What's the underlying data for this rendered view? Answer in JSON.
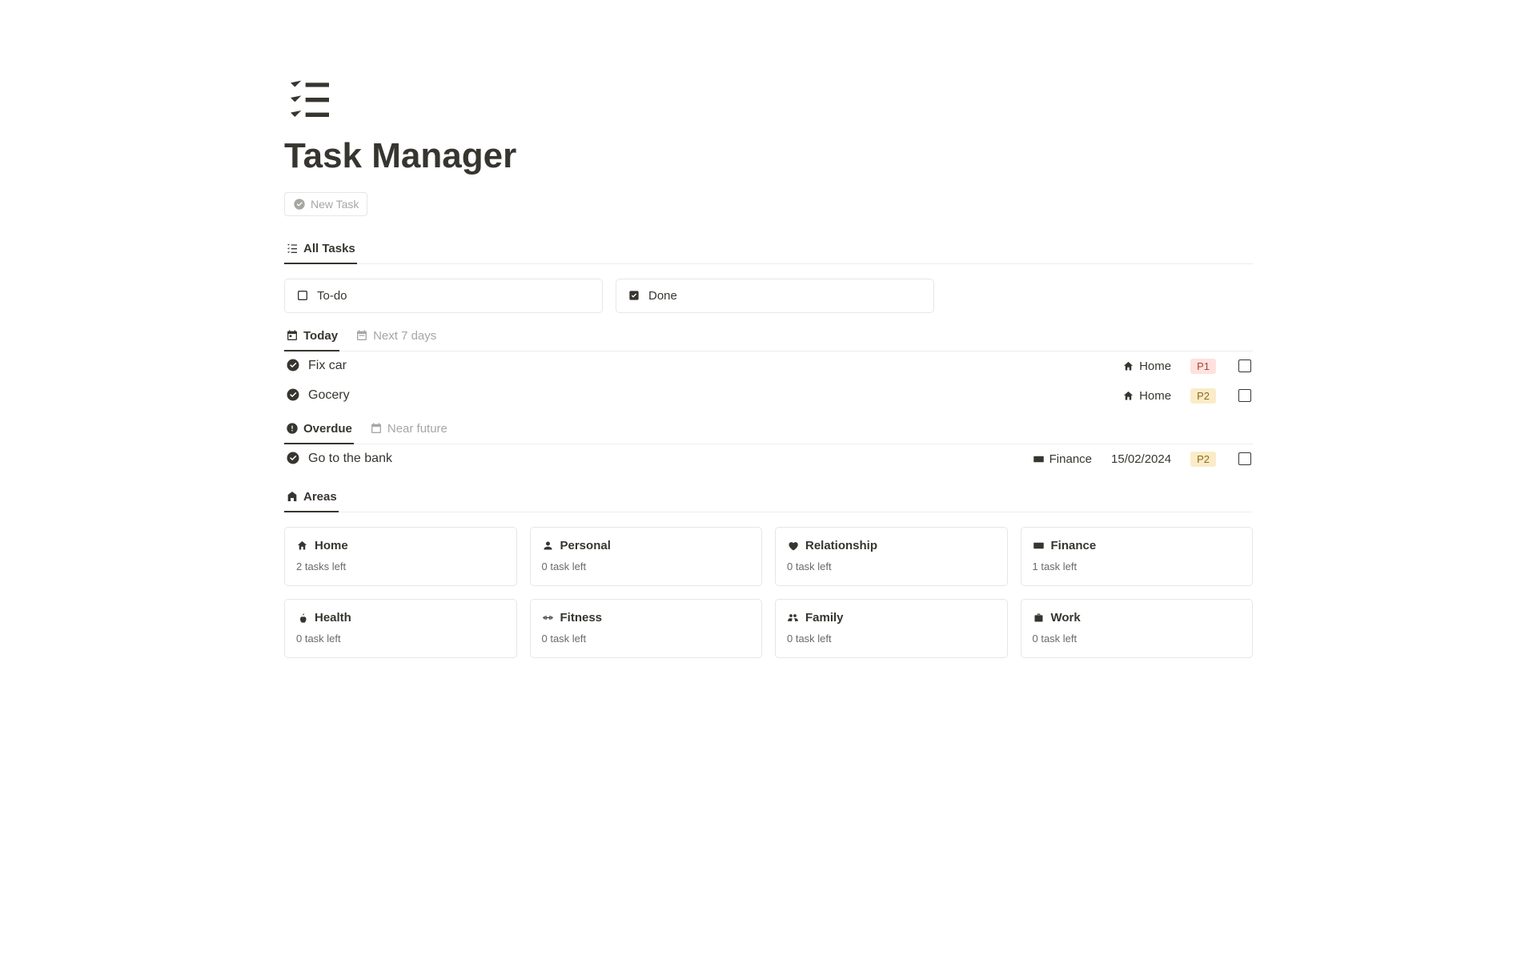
{
  "page": {
    "title": "Task Manager"
  },
  "newTask": {
    "label": "New Task"
  },
  "views": {
    "alltasks": {
      "label": "All Tasks"
    }
  },
  "statusFilters": {
    "todo": {
      "label": "To-do"
    },
    "done": {
      "label": "Done"
    }
  },
  "todayTabs": {
    "today": "Today",
    "next7": "Next 7 days"
  },
  "todayTasks": [
    {
      "name": "Fix car",
      "area": "Home",
      "area_icon": "home",
      "priority": "P1"
    },
    {
      "name": "Gocery",
      "area": "Home",
      "area_icon": "home",
      "priority": "P2"
    }
  ],
  "overdueTabs": {
    "overdue": "Overdue",
    "near": "Near future"
  },
  "overdueTasks": [
    {
      "name": "Go to the bank",
      "area": "Finance",
      "area_icon": "card",
      "date": "15/02/2024",
      "priority": "P2"
    }
  ],
  "areasTab": {
    "label": "Areas"
  },
  "areas": [
    {
      "name": "Home",
      "sub": "2 tasks left",
      "icon": "home"
    },
    {
      "name": "Personal",
      "sub": "0 task left",
      "icon": "user"
    },
    {
      "name": "Relationship",
      "sub": "0 task left",
      "icon": "heart"
    },
    {
      "name": "Finance",
      "sub": "1 task left",
      "icon": "card"
    },
    {
      "name": "Health",
      "sub": "0 task left",
      "icon": "apple"
    },
    {
      "name": "Fitness",
      "sub": "0 task left",
      "icon": "dumbbell"
    },
    {
      "name": "Family",
      "sub": "0 task left",
      "icon": "group"
    },
    {
      "name": "Work",
      "sub": "0 task left",
      "icon": "briefcase"
    }
  ],
  "priorityColors": {
    "P1": "prio-p1",
    "P2": "prio-p2"
  }
}
